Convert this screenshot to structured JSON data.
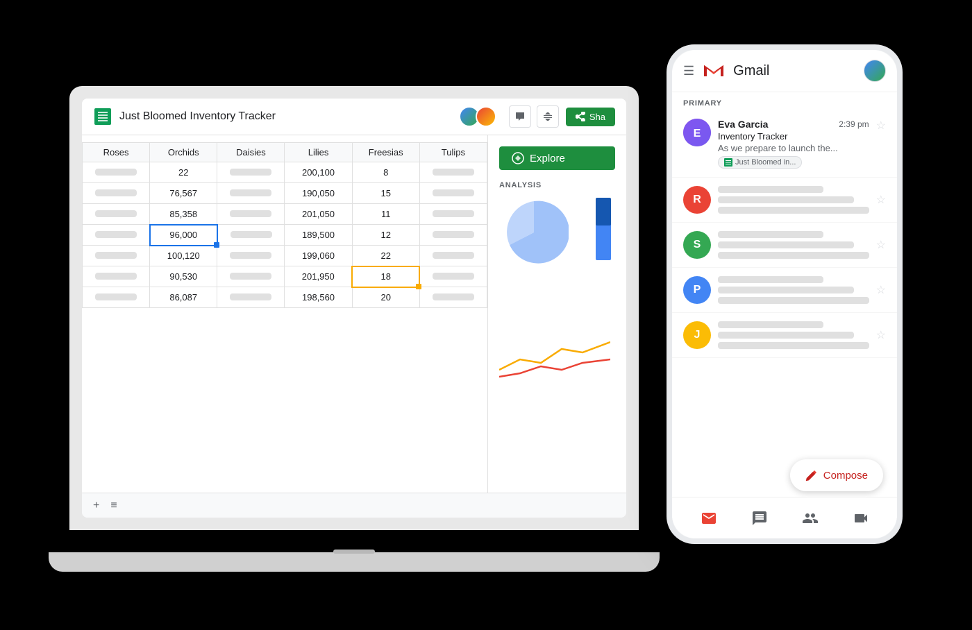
{
  "laptop": {
    "title": "Just Bloomed Inventory Tracker",
    "shareButton": "Sha",
    "exploreButton": "Explore",
    "analysisLabel": "ANALYSIS",
    "bottomIcons": {
      "plus": "+",
      "menu": "≡"
    }
  },
  "spreadsheet": {
    "headers": [
      "Roses",
      "Orchids",
      "Daisies",
      "Lilies",
      "Freesias",
      "Tulips"
    ],
    "rows": [
      {
        "orchids": "22",
        "lilies": "200,100",
        "freesias": "8"
      },
      {
        "orchids": "76,567",
        "lilies": "190,050",
        "freesias": "15"
      },
      {
        "orchids": "85,358",
        "lilies": "201,050",
        "freesias": "11"
      },
      {
        "orchids": "96,000",
        "lilies": "189,500",
        "freesias": "12",
        "highlightOrchids": "blue"
      },
      {
        "orchids": "100,120",
        "lilies": "199,060",
        "freesias": "22"
      },
      {
        "orchids": "90,530",
        "lilies": "201,950",
        "freesias": "18",
        "highlightFreesias": "yellow"
      },
      {
        "orchids": "86,087",
        "lilies": "198,560",
        "freesias": "20"
      }
    ]
  },
  "gmail": {
    "title": "Gmail",
    "primaryLabel": "PRIMARY",
    "email": {
      "sender": "Eva Garcia",
      "time": "2:39 pm",
      "subject": "Inventory Tracker",
      "preview": "As we prepare to launch the...",
      "chip": "Just Bloomed in..."
    },
    "composeLabel": "Compose"
  },
  "avatars": {
    "R": {
      "color": "#ea4335"
    },
    "S": {
      "color": "#34a853"
    },
    "P": {
      "color": "#4285f4"
    },
    "J": {
      "color": "#fbbc05"
    }
  }
}
